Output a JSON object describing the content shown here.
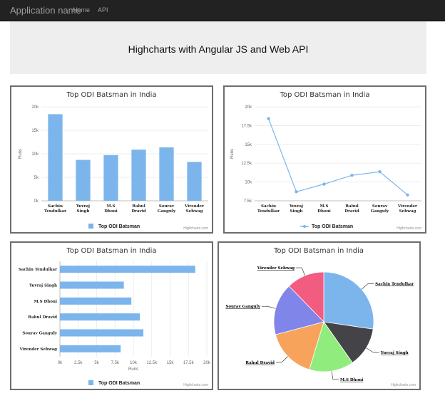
{
  "navbar": {
    "brand": "Application name",
    "links": [
      "Home",
      "API"
    ]
  },
  "jumbotron": {
    "title": "Highcharts with Angular JS and Web API"
  },
  "colors": {
    "bar": "#7cb5ec",
    "pie": [
      "#7cb5ec",
      "#434348",
      "#90ed7d",
      "#f7a35c",
      "#8085e9",
      "#f15c80"
    ]
  },
  "chart_data": [
    {
      "type": "bar",
      "title": "Top ODI Batsman in India",
      "ylabel": "Runs",
      "categories": [
        "Sachin Tendulkar",
        "Yuvraj Singh",
        "M.S Dhoni",
        "Rahul Dravid",
        "Sourav Ganguly",
        "Virender Sehwag"
      ],
      "series": [
        {
          "name": "Top ODI Batsman",
          "values": [
            18426,
            8701,
            9724,
            10889,
            11363,
            8273
          ]
        }
      ],
      "ylim": [
        0,
        20000
      ],
      "yticks": [
        "0k",
        "5k",
        "10k",
        "15k",
        "20k"
      ],
      "credit": "Highcharts.com"
    },
    {
      "type": "line",
      "title": "Top ODI Batsman in India",
      "ylabel": "Runs",
      "categories": [
        "Sachin Tendulkar",
        "Yuvraj Singh",
        "M.S Dhoni",
        "Rahul Dravid",
        "Sourav Ganguly",
        "Virender Sehwag"
      ],
      "series": [
        {
          "name": "Top ODI Batsman",
          "values": [
            18426,
            8701,
            9724,
            10889,
            11363,
            8273
          ]
        }
      ],
      "ylim": [
        7500,
        20000
      ],
      "yticks": [
        "7.5k",
        "10k",
        "12.5k",
        "15k",
        "17.5k",
        "20k"
      ],
      "credit": "Highcharts.com"
    },
    {
      "type": "bar",
      "orientation": "horizontal",
      "title": "Top ODI Batsman in India",
      "xlabel": "Runs",
      "categories": [
        "Sachin Tendulkar",
        "Yuvraj Singh",
        "M.S Dhoni",
        "Rahul Dravid",
        "Sourav Ganguly",
        "Virender Sehwag"
      ],
      "series": [
        {
          "name": "Top ODI Batsman",
          "values": [
            18426,
            8701,
            9724,
            10889,
            11363,
            8273
          ]
        }
      ],
      "xlim": [
        0,
        20000
      ],
      "xticks": [
        "0k",
        "2.5k",
        "5k",
        "7.5k",
        "10k",
        "12.5k",
        "15k",
        "17.5k",
        "20k"
      ],
      "credit": "Highcharts.com"
    },
    {
      "type": "pie",
      "title": "Top ODI Batsman in India",
      "categories": [
        "Sachin Tendulkar",
        "Yuvraj Singh",
        "M.S Dhoni",
        "Rahul Dravid",
        "Sourav Ganguly",
        "Virender Sehwag"
      ],
      "values": [
        18426,
        8701,
        9724,
        10889,
        11363,
        8273
      ],
      "credit": "Highcharts.com"
    }
  ]
}
